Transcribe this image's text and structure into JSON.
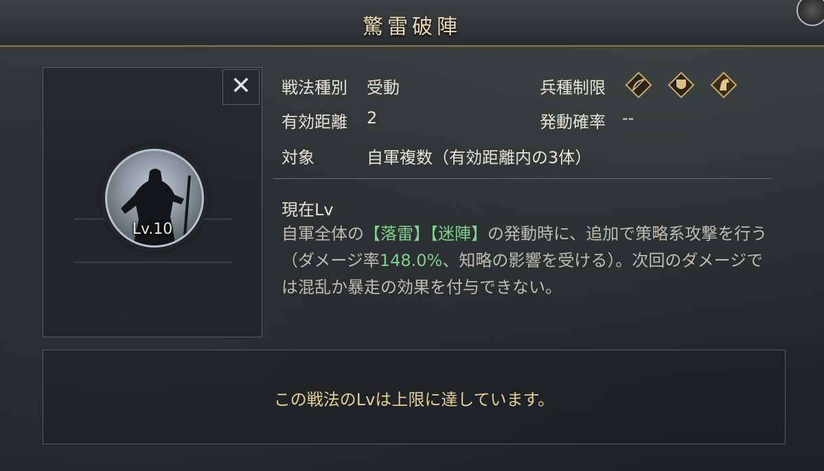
{
  "window": {
    "title": "驚雷破陣"
  },
  "close_button": {
    "label": "✕"
  },
  "portrait": {
    "level_label": "Lv.10"
  },
  "info": {
    "type_label": "戦法種別",
    "type_value": "受動",
    "range_label": "有効距離",
    "range_value": "2",
    "target_label": "対象",
    "target_value": "自軍複数（有効距離内の3体）",
    "troop_label": "兵種制限",
    "troop_icons": [
      "bow-icon",
      "shield-icon",
      "horse-icon"
    ],
    "rate_label": "発動確率",
    "rate_value": "--"
  },
  "description": {
    "heading": "現在Lv",
    "p1": "自軍全体の",
    "hl1": "【落雷】",
    "hl2": "【迷陣】",
    "p2": "の発動時に、追加で策略系攻撃を行う（ダメージ率",
    "rate": "148.0%",
    "p3": "、知略の影響を受ける）。次回のダメージでは混乱か暴走の効果を付与できない。"
  },
  "footer": {
    "message": "この戦法のLvは上限に達しています。"
  },
  "colors": {
    "accent_gold": "#e9d9b4",
    "highlight_green": "#7fcf8e",
    "message_gold": "#e2cf95"
  }
}
